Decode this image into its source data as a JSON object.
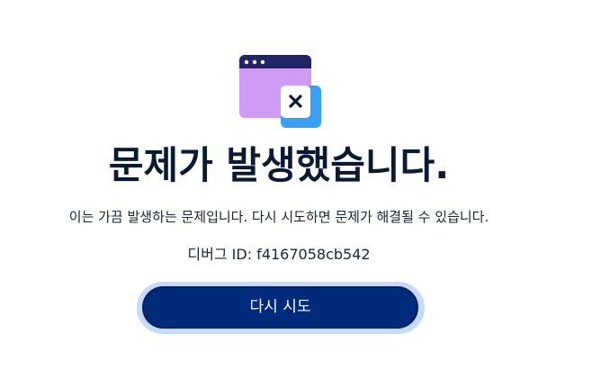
{
  "error": {
    "illustration_icon": "browser-window-error-icon",
    "title": "문제가 발생했습니다.",
    "message": "이는 가끔 발생하는 문제입니다. 다시 시도하면 문제가 해결될 수 있습니다.",
    "debug_id": "디버그 ID: f4167058cb542",
    "retry_label": "다시 시도"
  },
  "colors": {
    "window_header": "#1f2566",
    "window_body": "#cf9bf5",
    "badge_outer": "#3aa0f5",
    "badge_inner": "#ffffff",
    "close_mark": "#0b1a33",
    "button_bg": "#002a7a",
    "button_ring": "#c5dafd",
    "title_text": "#0b1a33"
  }
}
